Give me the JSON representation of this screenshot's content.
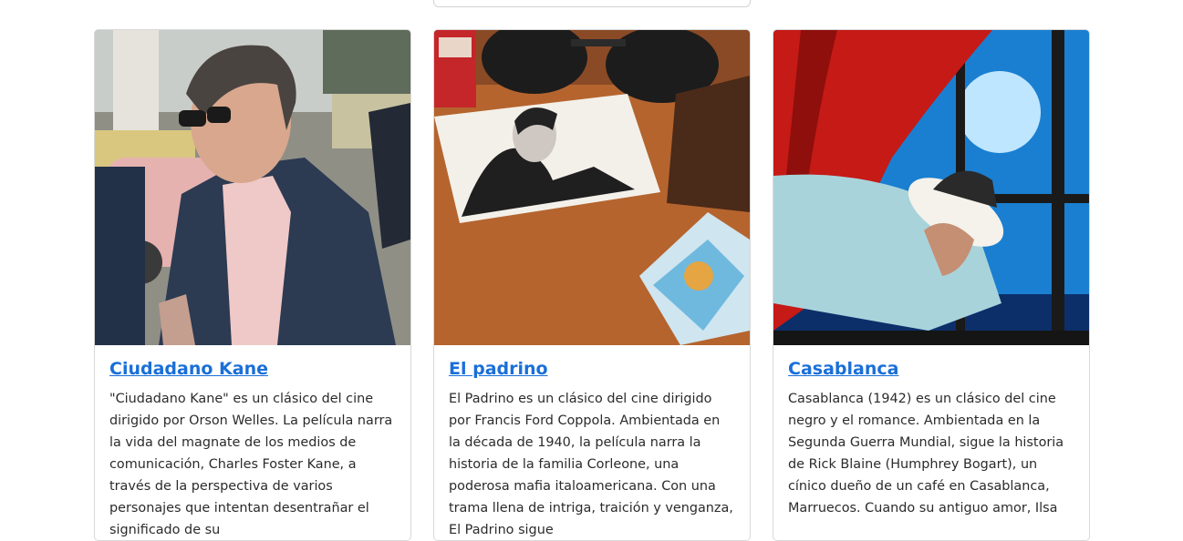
{
  "cards": [
    {
      "title": "Ciudadano Kane",
      "text": "\"Ciudadano Kane\" es un clásico del cine dirigido por Orson Welles. La película narra la vida del magnate de los medios de comunicación, Charles Foster Kane, a través de la perspectiva de varios personajes que intentan desentrañar el significado de su",
      "image": "man-in-suit-with-sunglasses-street-image"
    },
    {
      "title": "El padrino",
      "text": "El Padrino es un clásico del cine dirigido por Francis Ford Coppola. Ambientada en la década de 1940, la película narra la historia de la familia Corleone, una poderosa mafia italoamericana. Con una trama llena de intriga, traición y venganza, El Padrino sigue",
      "image": "portrait-sketch-on-table-image"
    },
    {
      "title": "Casablanca",
      "text": "Casablanca (1942) es un clásico del cine negro y el romance. Ambientada en la Segunda Guerra Mundial, sigue la historia de Rick Blaine (Humphrey Bogart), un cínico dueño de un café en Casablanca, Marruecos. Cuando su antiguo amor, Ilsa",
      "image": "man-with-hat-by-window-curtain-image"
    }
  ],
  "colors": {
    "link": "#1a6fd8",
    "text": "#2b2b2b",
    "border": "#d9d9d9"
  }
}
